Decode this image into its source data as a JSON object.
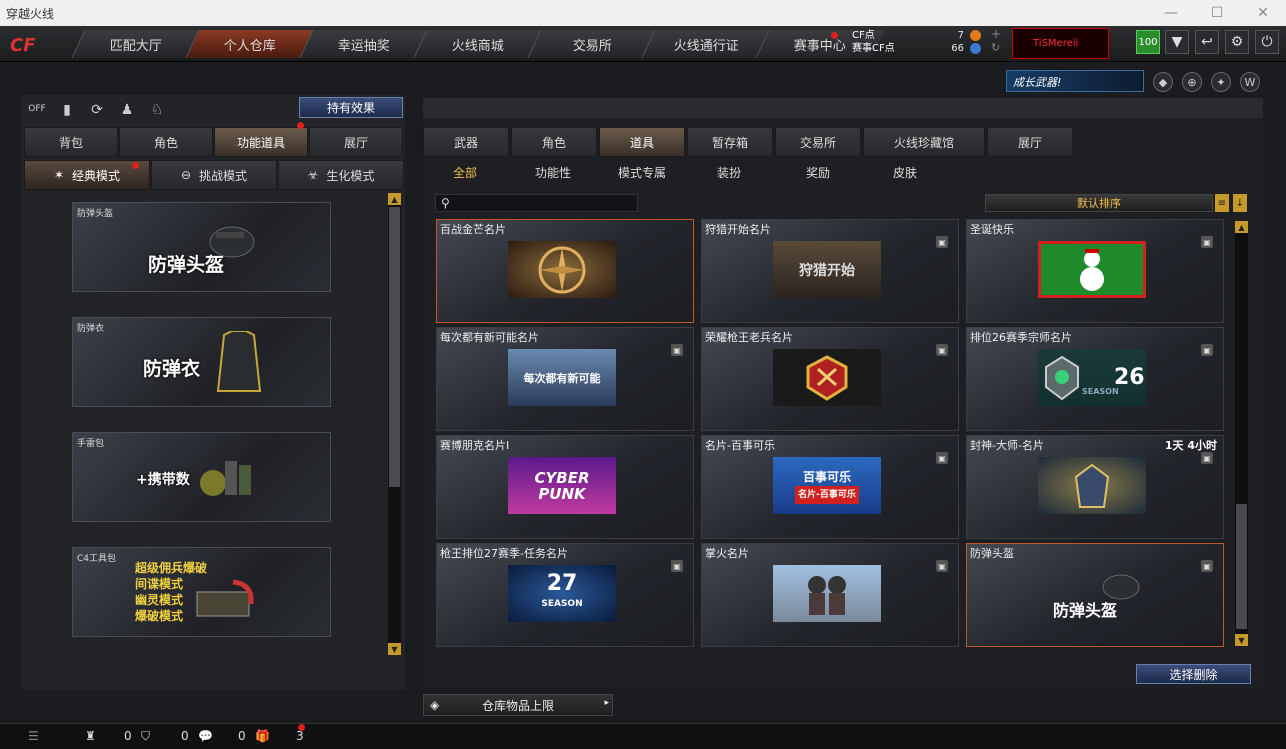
{
  "window": {
    "title": "穿越火线"
  },
  "nav": {
    "tabs": [
      "匹配大厅",
      "个人仓库",
      "幸运抽奖",
      "火线商城",
      "交易所",
      "火线通行证",
      "赛事中心"
    ],
    "active_index": 1
  },
  "points": {
    "cf_label": "CF点",
    "cf_value": "7",
    "match_label": "赛事CF点",
    "match_value": "66"
  },
  "player": {
    "name": "TiSMereii"
  },
  "level": "100",
  "banner": {
    "text": "成长武器!"
  },
  "left": {
    "effect_button": "持有效果",
    "tabs": [
      "背包",
      "角色",
      "功能道具",
      "展厅"
    ],
    "active_tab": 2,
    "modes": [
      "经典模式",
      "挑战模式",
      "生化模式"
    ],
    "active_mode": 0,
    "cards": [
      {
        "caption": "防弹头盔",
        "title": "防弹头盔"
      },
      {
        "caption": "防弹衣",
        "title": "防弹衣"
      },
      {
        "caption": "手雷包",
        "title": "+携带数"
      },
      {
        "caption": "C4工具包",
        "lines": [
          "超级佣兵爆破",
          "间谍模式",
          "幽灵模式",
          "爆破模式"
        ]
      }
    ]
  },
  "right": {
    "tabs": [
      "武器",
      "角色",
      "道具",
      "暂存箱",
      "交易所",
      "火线珍藏馆",
      "展厅"
    ],
    "active_tab": 2,
    "subtabs": [
      "全部",
      "功能性",
      "模式专属",
      "装扮",
      "奖励",
      "皮肤"
    ],
    "active_subtab": 0,
    "search": {
      "placeholder": ""
    },
    "sort_label": "默认排序",
    "items": [
      {
        "name": "百战金芒名片",
        "img_text": ""
      },
      {
        "name": "狩猎开始名片",
        "img_text": "狩猎开始"
      },
      {
        "name": "圣诞快乐",
        "img_text": ""
      },
      {
        "name": "每次都有新可能名片",
        "img_text": "每次都有新可能"
      },
      {
        "name": "荣耀枪王老兵名片",
        "img_text": ""
      },
      {
        "name": "排位26赛季宗师名片",
        "img_text": "26",
        "img_sub": "SEASON"
      },
      {
        "name": "赛博朋克名片I",
        "img_text": "CYBER",
        "img_sub": "PUNK"
      },
      {
        "name": "名片-百事可乐",
        "img_text": "百事可乐",
        "img_sub": "名片-百事可乐"
      },
      {
        "name": "封神-大师-名片",
        "img_text": "",
        "timer": "1天 4小时"
      },
      {
        "name": "枪王排位27赛季-任务名片",
        "img_text": "27",
        "img_sub": "SEASON"
      },
      {
        "name": "掌火名片",
        "img_text": ""
      },
      {
        "name": "防弹头盔",
        "img_text": "防弹头盔"
      }
    ],
    "delete_button": "选择删除",
    "capacity_button": "仓库物品上限"
  },
  "status": {
    "counts": [
      "0",
      "0",
      "0",
      "3"
    ]
  },
  "colors": {
    "accent": "#c0562a",
    "gold": "#f0c04a",
    "panel": "#232427"
  }
}
